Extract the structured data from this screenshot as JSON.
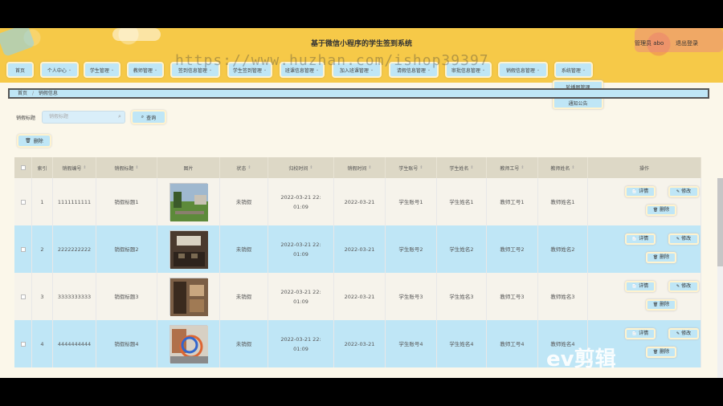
{
  "header": {
    "title": "基于微信小程序的学生签到系统",
    "admin": "管理员 abo",
    "logout": "退出登录"
  },
  "nav": [
    {
      "label": "首页",
      "chev": ""
    },
    {
      "label": "个人中心",
      "chev": "⌄"
    },
    {
      "label": "学生管理",
      "chev": "⌄"
    },
    {
      "label": "教师管理",
      "chev": "⌄"
    },
    {
      "label": "签到信息管理",
      "chev": "⌄"
    },
    {
      "label": "学生签到管理",
      "chev": "⌄"
    },
    {
      "label": "班课信息管理",
      "chev": "⌄"
    },
    {
      "label": "加入班课管理",
      "chev": "⌄"
    },
    {
      "label": "请假信息管理",
      "chev": "⌄"
    },
    {
      "label": "审批信息管理",
      "chev": "⌄"
    },
    {
      "label": "销假信息管理",
      "chev": "⌄"
    },
    {
      "label": "系统管理",
      "chev": "⌄"
    }
  ],
  "dropdown": [
    "轮播图管理",
    "通知公告"
  ],
  "breadcrumb": {
    "home": "首页",
    "sep": "/",
    "current": "销假信息"
  },
  "search": {
    "label": "销假标题",
    "placeholder": "销假标题",
    "button": "查询"
  },
  "toolbar": {
    "delete": "删除"
  },
  "table": {
    "headers": [
      "",
      "索引",
      "销假编号",
      "销假标题",
      "图片",
      "状态",
      "归校时间",
      "销假时间",
      "学生账号",
      "学生姓名",
      "教师工号",
      "教师姓名",
      "操作"
    ],
    "rows": [
      {
        "index": "1",
        "code": "1111111111",
        "title": "销假标题1",
        "status": "未销假",
        "return_time": "2022-03-21 22:01:09",
        "cancel_date": "2022-03-21",
        "stu_acc": "学生账号1",
        "stu_name": "学生姓名1",
        "tea_no": "教师工号1",
        "tea_name": "教师姓名1",
        "img": "campus"
      },
      {
        "index": "2",
        "code": "2222222222",
        "title": "销假标题2",
        "status": "未销假",
        "return_time": "2022-03-21 22:01:09",
        "cancel_date": "2022-03-21",
        "stu_acc": "学生账号2",
        "stu_name": "学生姓名2",
        "tea_no": "教师工号2",
        "tea_name": "教师姓名2",
        "img": "classroom"
      },
      {
        "index": "3",
        "code": "3333333333",
        "title": "销假标题3",
        "status": "未销假",
        "return_time": "2022-03-21 22:01:09",
        "cancel_date": "2022-03-21",
        "stu_acc": "学生账号3",
        "stu_name": "学生姓名3",
        "tea_no": "教师工号3",
        "tea_name": "教师姓名3",
        "img": "dorm"
      },
      {
        "index": "4",
        "code": "4444444444",
        "title": "销假标题4",
        "status": "未销假",
        "return_time": "2022-03-21 22:01:09",
        "cancel_date": "2022-03-21",
        "stu_acc": "学生账号4",
        "stu_name": "学生姓名4",
        "tea_no": "教师工号4",
        "tea_name": "教师姓名4",
        "img": "sculpture"
      }
    ],
    "ops": {
      "detail": "详情",
      "edit": "修改",
      "delete": "删除"
    }
  },
  "watermark": "https://www.huzhan.com/ishop39397",
  "ev_logo": "ev剪辑",
  "colors": {
    "header": "#f6c948",
    "button": "#bfe6f6",
    "row_alt": "#bfe6f6"
  }
}
